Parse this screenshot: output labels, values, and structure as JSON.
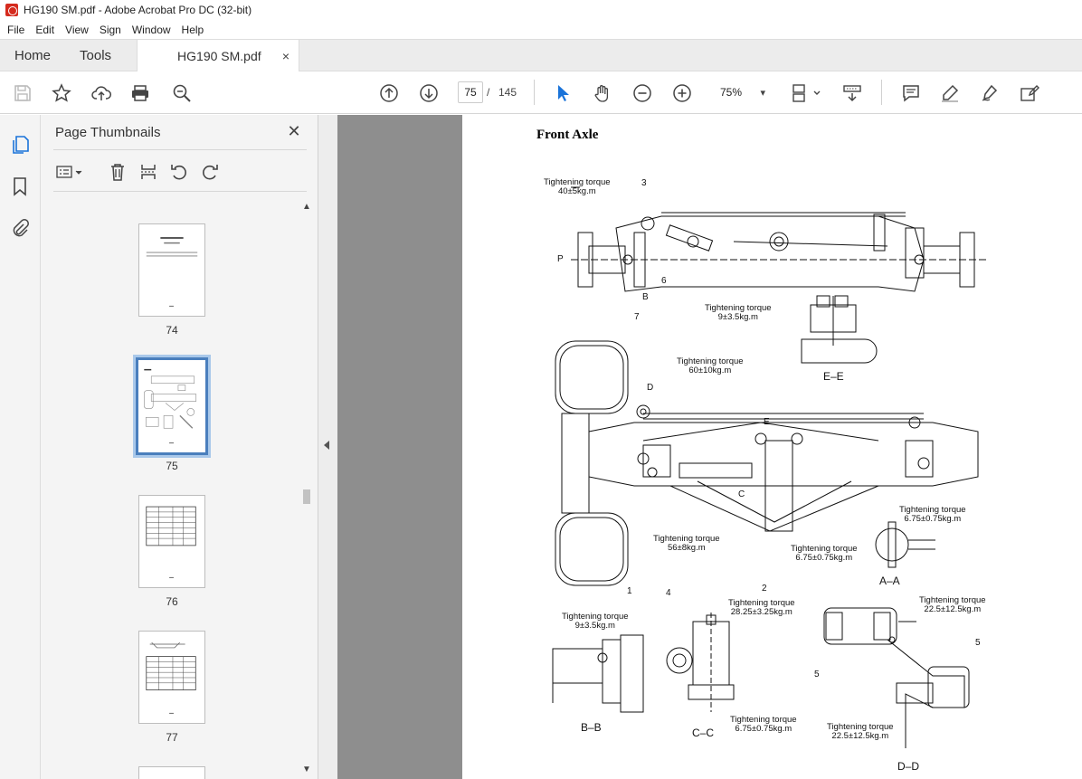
{
  "window": {
    "title": "HG190 SM.pdf - Adobe Acrobat Pro DC (32-bit)"
  },
  "menu": [
    "File",
    "Edit",
    "View",
    "Sign",
    "Window",
    "Help"
  ],
  "tabs": {
    "home": "Home",
    "tools": "Tools",
    "document": "HG190 SM.pdf",
    "close": "×"
  },
  "toolbar": {
    "current_page": "75",
    "separator": "/",
    "total_pages": "145",
    "zoom": "75%",
    "zoom_arrow": "▾"
  },
  "panel": {
    "title": "Page Thumbnails",
    "close": "✕",
    "thumbnails": [
      {
        "label": "74"
      },
      {
        "label": "75",
        "selected": true
      },
      {
        "label": "76"
      },
      {
        "label": "77"
      }
    ]
  },
  "document": {
    "title": "Front Axle",
    "labels": {
      "t1": "Tightening torque",
      "t1v": "40±5kg.m",
      "t2": "Tightening torque",
      "t2v": "9±3.5kg.m",
      "t3": "Tightening torque",
      "t3v": "60±10kg.m",
      "t4": "Tightening torque",
      "t4v": "6.75±0.75kg.m",
      "t5": "Tightening torque",
      "t5v": "56±8kg.m",
      "t6": "Tightening torque",
      "t6v": "6.75±0.75kg.m",
      "t7": "Tightening torque",
      "t7v": "9±3.5kg.m",
      "t8": "Tightening torque",
      "t8v": "28.25±3.25kg.m",
      "t9": "Tightening torque",
      "t9v": "22.5±12.5kg.m",
      "t10": "Tightening torque",
      "t10v": "6.75±0.75kg.m",
      "t11": "Tightening torque",
      "t11v": "22.5±12.5kg.m"
    },
    "sections": {
      "ee": "E–E",
      "aa": "A–A",
      "bb": "B–B",
      "cc": "C–C",
      "dd": "D–D"
    },
    "numbers": {
      "n3": "3",
      "nP": "P",
      "n6": "6",
      "nB": "B",
      "n7": "7",
      "nD": "D",
      "nE": "E",
      "nC": "C",
      "n1": "1",
      "n2": "2",
      "n4": "4",
      "n5a": "5",
      "n5b": "5"
    }
  }
}
